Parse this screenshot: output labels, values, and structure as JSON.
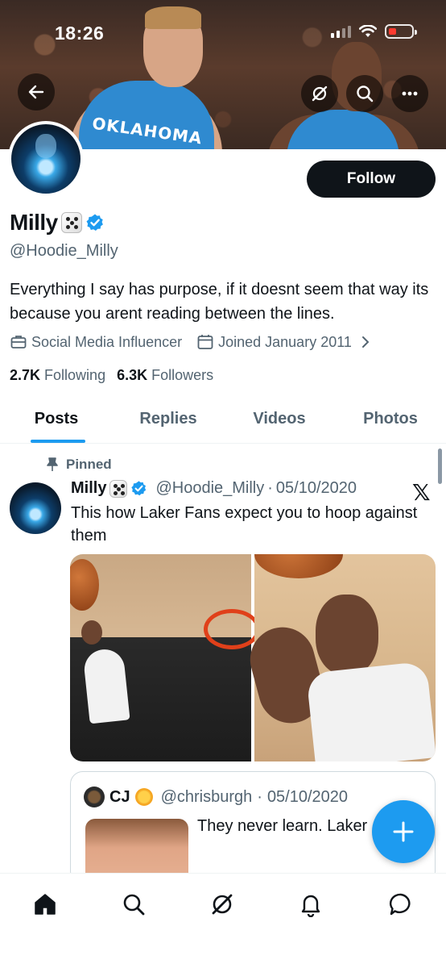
{
  "status_bar": {
    "time": "18:26"
  },
  "profile": {
    "display_name": "Milly",
    "handle": "@Hoodie_Milly",
    "bio": "Everything I say has purpose, if it doesnt seem that way its because you arent reading between the lines.",
    "category": "Social Media Influencer",
    "joined": "Joined January 2011",
    "following_count": "2.7K",
    "following_label": "Following",
    "followers_count": "6.3K",
    "followers_label": "Followers",
    "follow_label": "Follow",
    "banner_text": "OKLAHOMA"
  },
  "tabs": [
    {
      "label": "Posts",
      "active": true
    },
    {
      "label": "Replies",
      "active": false
    },
    {
      "label": "Videos",
      "active": false
    },
    {
      "label": "Photos",
      "active": false
    }
  ],
  "pinned_tweet": {
    "pinned_label": "Pinned",
    "author_name": "Milly",
    "author_handle": "@Hoodie_Milly",
    "date": "05/10/2020",
    "text": "This how Laker Fans expect you to hoop against them",
    "quote": {
      "name": "CJ",
      "handle": "@chrisburgh",
      "date": "05/10/2020",
      "text": "They never learn. Laker"
    }
  },
  "colors": {
    "accent": "#1d9bf0",
    "text": "#0f1419",
    "muted": "#536471",
    "low_battery": "#ff3b30"
  },
  "icons": [
    "back-arrow-icon",
    "grok-icon",
    "search-icon",
    "more-icon",
    "briefcase-icon",
    "calendar-icon",
    "chevron-right-icon",
    "pin-icon",
    "verified-icon",
    "x-logo-icon",
    "compose-plus-icon",
    "home-icon",
    "bell-icon",
    "messages-icon"
  ]
}
